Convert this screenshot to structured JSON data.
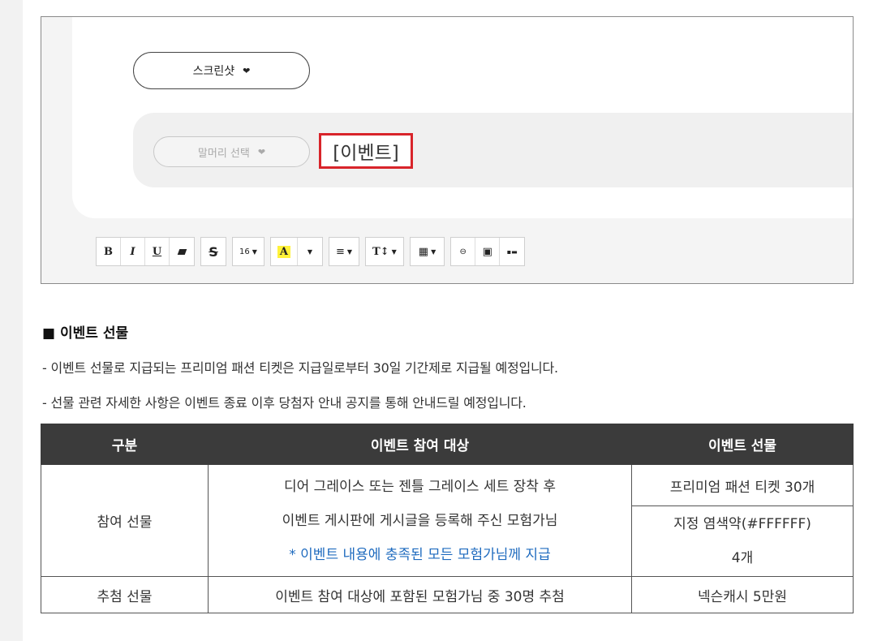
{
  "editor": {
    "category_select": "스크린샷",
    "heading_select": "말머리 선택",
    "title_value": "[이벤트]",
    "toolbar": {
      "bold": "B",
      "italic": "I",
      "underline": "U",
      "strike": "S",
      "font_size": "16",
      "text_color": "A",
      "align": "≡",
      "text_style": "T↕",
      "table": "▦",
      "link": "⊖",
      "image": "▣",
      "video": "▪▬"
    }
  },
  "section": {
    "title": "■ 이벤트 선물",
    "desc1": "- 이벤트 선물로 지급되는 프리미엄 패션 티켓은 지급일로부터 30일 기간제로 지급될 예정입니다.",
    "desc2": "- 선물 관련 자세한 사항은 이벤트 종료 이후 당첨자 안내 공지를 통해 안내드릴 예정입니다."
  },
  "table": {
    "headers": [
      "구분",
      "이벤트 참여 대상",
      "이벤트 선물"
    ],
    "row1": {
      "category": "참여 선물",
      "target_lines": [
        "디어 그레이스 또는 젠틀 그레이스 세트 장착 후",
        "이벤트 게시판에 게시글을 등록해 주신 모험가님",
        "* 이벤트 내용에 충족된 모든 모험가님께 지급"
      ],
      "gift1": "프리미엄 패션 티켓 30개",
      "gift2_line1": "지정 염색약(#FFFFFF)",
      "gift2_line2": "4개"
    },
    "row2": {
      "category": "추첨 선물",
      "target": "이벤트 참여 대상에 포함된 모험가님 중 30명 추첨",
      "gift": "넥슨캐시 5만원"
    }
  }
}
